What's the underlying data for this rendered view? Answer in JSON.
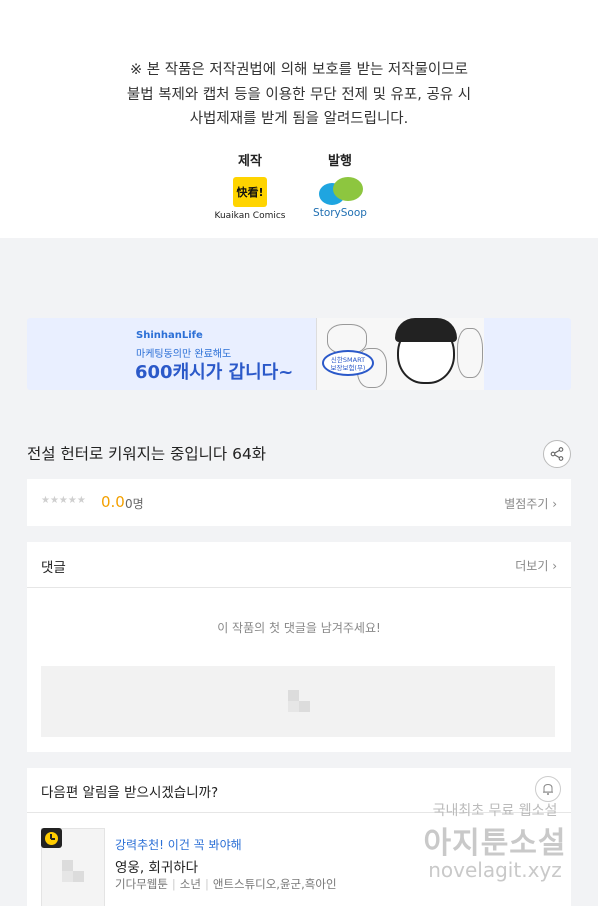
{
  "notice": {
    "line1": "※ 본 작품은 저작권법에 의해 보호를 받는 저작물이므로",
    "line2": "불법 복제와 캡처 등을  이용한 무단 전제 및 유포, 공유 시",
    "line3": "사법제재를  받게 됨을 알려드립니다."
  },
  "credits": {
    "maker_label": "제작",
    "maker_logo_text": "快看!",
    "maker_name": "Kuaikan Comics",
    "publisher_label": "발행",
    "publisher_name": "StorySoop"
  },
  "banner": {
    "brand": "ShinhanLife",
    "subtitle": "마케팅동의만 완료해도",
    "headline": "600캐시가 갑니다~",
    "badge_line1": "신한SMART",
    "badge_line2": "보장보험(무)"
  },
  "episode": {
    "title": "전설 헌터로 키워지는 중입니다 64화"
  },
  "rating": {
    "stars": "★★★★★",
    "score": "0.0",
    "count": "0명",
    "rate_link": "별점주기 ›"
  },
  "comments": {
    "title": "댓글",
    "more_link": "더보기 ›",
    "empty_message": "이 작품의 첫 댓글을 남겨주세요!"
  },
  "notify": {
    "question": "다음편 알림을 받으시겠습니까?",
    "rec_tag": "강력추천! 이건 꼭 봐야해",
    "rec_title": "영웅, 회귀하다",
    "rec_genre1": "기다무웹툰",
    "rec_genre2": "소년",
    "rec_authors": "앤트스튜디오,윤군,흑아인"
  },
  "watermark": {
    "top": "국내최초 무료 웹소설",
    "middle": "아지툰소설",
    "bottom": "novelagit.xyz"
  },
  "colors": {
    "accent_blue": "#2b6fd6",
    "score_orange": "#f3a000",
    "kuaikan_yellow": "#ffd400",
    "background": "#f2f3f5"
  }
}
